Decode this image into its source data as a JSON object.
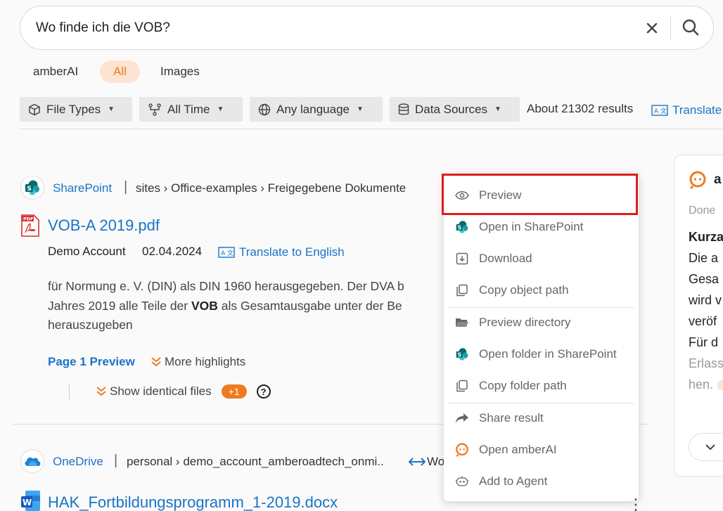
{
  "search": {
    "query": "Wo finde ich die VOB?"
  },
  "tabs": [
    {
      "label": "amberAI"
    },
    {
      "label": "All"
    },
    {
      "label": "Images"
    }
  ],
  "filters": {
    "file_types": "File Types",
    "time": "All Time",
    "language": "Any language",
    "sources": "Data Sources",
    "results_count": "About 21302 results",
    "translate": "Translate"
  },
  "results": [
    {
      "source": "SharePoint",
      "path": "sites › Office-examples › Freigegebene Dokumente",
      "title": "VOB-A 2019.pdf",
      "author": "Demo Account",
      "date": "02.04.2024",
      "translate": "Translate to English",
      "snippet_line1": "für Normung e. V. (DIN) als DIN 1960 herausgegeben. Der DVA b",
      "snippet_line2_pre": "Jahres 2019 alle Teile der ",
      "snippet_line2_bold": "VOB",
      "snippet_line2_post": " als Gesamtausgabe unter der Be",
      "snippet_line3": "herauszugeben",
      "page_preview": "Page 1 Preview",
      "more_highlights": "More highlights",
      "identical_files": "Show identical files",
      "identical_count": "+1",
      "help": "?"
    },
    {
      "source": "OneDrive",
      "path": "personal › demo_account_amberoadtech_onmi..",
      "path_suffix": "Wo",
      "title": "HAK_Fortbildungsprogramm_1-2019.docx"
    }
  ],
  "menu": {
    "items": [
      {
        "label": "Preview",
        "icon": "eye-icon"
      },
      {
        "label": "Open in SharePoint",
        "icon": "sharepoint-icon"
      },
      {
        "label": "Download",
        "icon": "download-icon"
      },
      {
        "label": "Copy object path",
        "icon": "copy-icon"
      },
      {
        "label": "Preview directory",
        "icon": "folder-open-icon"
      },
      {
        "label": "Open folder in SharePoint",
        "icon": "sharepoint-icon"
      },
      {
        "label": "Copy folder path",
        "icon": "copy-icon"
      },
      {
        "label": "Share result",
        "icon": "share-icon"
      },
      {
        "label": "Open amberAI",
        "icon": "amberai-icon"
      },
      {
        "label": "Add to Agent",
        "icon": "robot-icon"
      }
    ]
  },
  "ai_panel": {
    "title_fragment": "a",
    "status": "Done",
    "lines": [
      "Kurza",
      "Die a",
      "Gesa",
      "wird v",
      "veröf",
      "Für d",
      "Erlass",
      "hen."
    ]
  },
  "colors": {
    "accent": "#ef7a1f",
    "link": "#1a73c8",
    "highlight": "#e01b1b"
  }
}
